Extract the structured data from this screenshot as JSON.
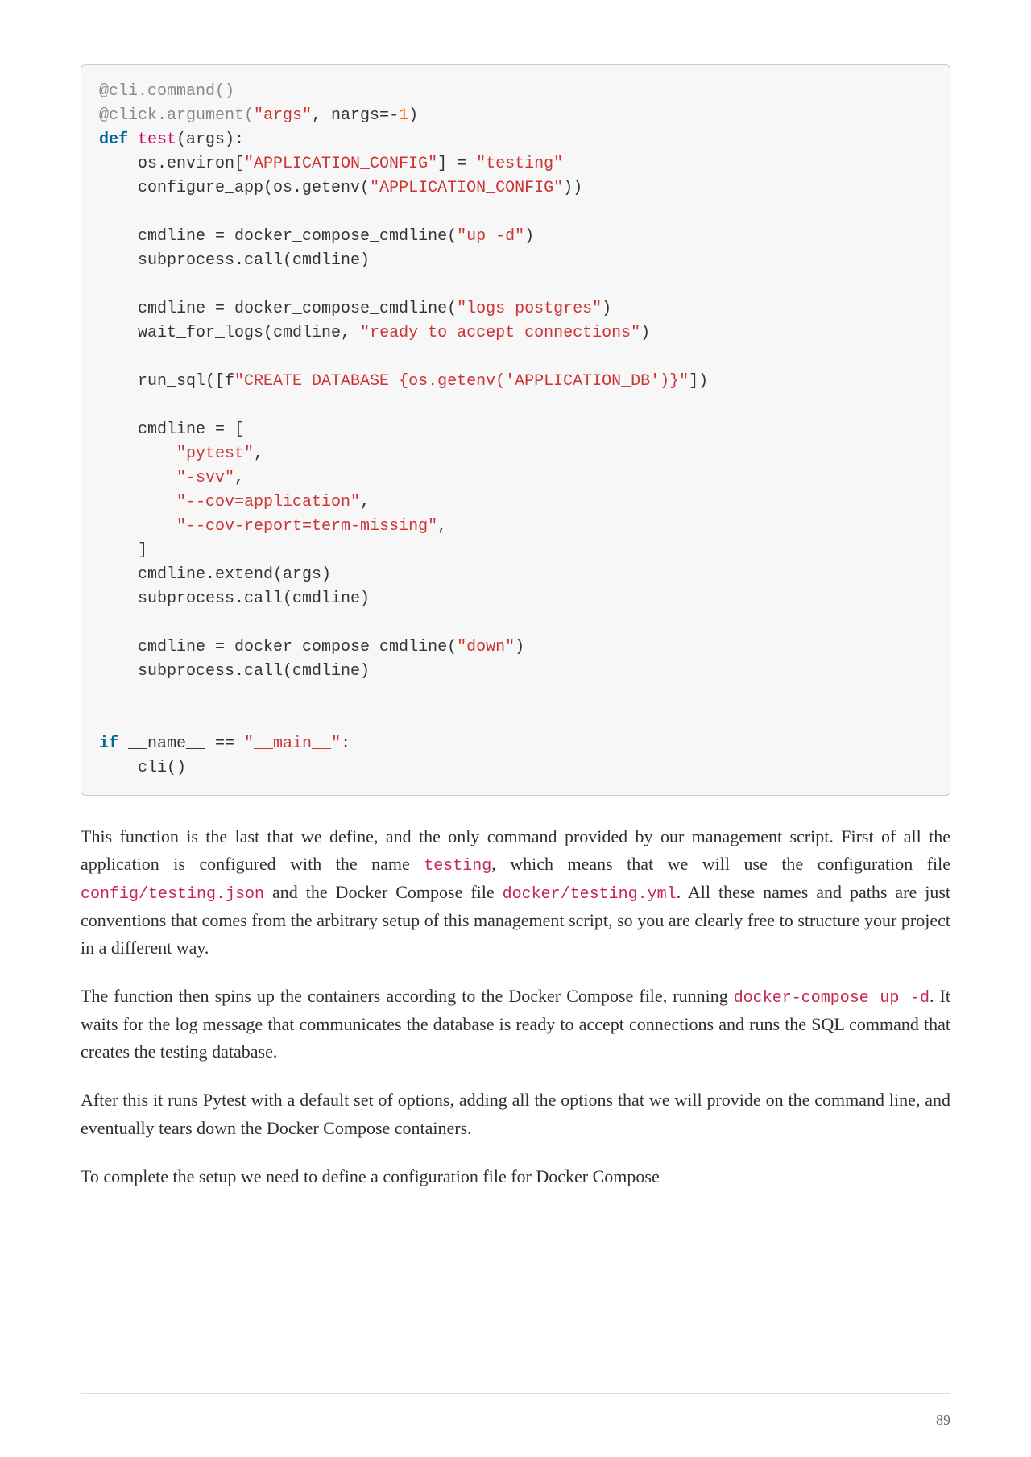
{
  "page_number": "89",
  "code": {
    "l01_dec": "@cli.command()",
    "l02_dec": "@click.argument(",
    "l02_str": "\"args\"",
    "l02_rest": ", nargs=-",
    "l02_num": "1",
    "l02_close": ")",
    "l03_def": "def ",
    "l03_name": "test",
    "l03_sig": "(args):",
    "l04_a": "    os.environ[",
    "l04_s1": "\"APPLICATION_CONFIG\"",
    "l04_b": "] = ",
    "l04_s2": "\"testing\"",
    "l05_a": "    configure_app(os.getenv(",
    "l05_s1": "\"APPLICATION_CONFIG\"",
    "l05_b": "))",
    "l07_a": "    cmdline = docker_compose_cmdline(",
    "l07_s1": "\"up -d\"",
    "l07_b": ")",
    "l08": "    subprocess.call(cmdline)",
    "l10_a": "    cmdline = docker_compose_cmdline(",
    "l10_s1": "\"logs postgres\"",
    "l10_b": ")",
    "l11_a": "    wait_for_logs(cmdline, ",
    "l11_s1": "\"ready to accept connections\"",
    "l11_b": ")",
    "l13_a": "    run_sql([f",
    "l13_s1": "\"CREATE DATABASE ",
    "l13_exp": "{os.getenv('APPLICATION_DB')}",
    "l13_s2": "\"",
    "l13_b": "])",
    "l15": "    cmdline = [",
    "l16_a": "        ",
    "l16_s": "\"pytest\"",
    "l16_c": ",",
    "l17_a": "        ",
    "l17_s": "\"-svv\"",
    "l17_c": ",",
    "l18_a": "        ",
    "l18_s": "\"--cov=application\"",
    "l18_c": ",",
    "l19_a": "        ",
    "l19_s": "\"--cov-report=term-missing\"",
    "l19_c": ",",
    "l20": "    ]",
    "l21": "    cmdline.extend(args)",
    "l22": "    subprocess.call(cmdline)",
    "l24_a": "    cmdline = docker_compose_cmdline(",
    "l24_s1": "\"down\"",
    "l24_b": ")",
    "l25": "    subprocess.call(cmdline)",
    "l28_if": "if",
    "l28_a": " __name__ == ",
    "l28_s": "\"__main__\"",
    "l28_c": ":",
    "l29": "    cli()"
  },
  "prose": {
    "p1_a": "This function is the last that we define, and the only command provided by our management script. First of all the application is configured with the name ",
    "p1_c1": "testing",
    "p1_b": ", which means that we will use the configuration file ",
    "p1_c2": "config/testing.json",
    "p1_c": " and the Docker Compose file ",
    "p1_c3": "docker/testing.yml",
    "p1_d": ". All these names and paths are just conventions that comes from the arbitrary setup of this management script, so you are clearly free to structure your project in a different way.",
    "p2_a": "The function then spins up the containers according to the Docker Compose file, running ",
    "p2_c1": "docker-compose up -d",
    "p2_b": ". It waits for the log message that communicates the database is ready to accept connections and runs the SQL command that creates the testing database.",
    "p3": "After this it runs Pytest with a default set of options, adding all the options that we will provide on the command line, and eventually tears down the Docker Compose containers.",
    "p4": "To complete the setup we need to define a configuration file for Docker Compose"
  }
}
